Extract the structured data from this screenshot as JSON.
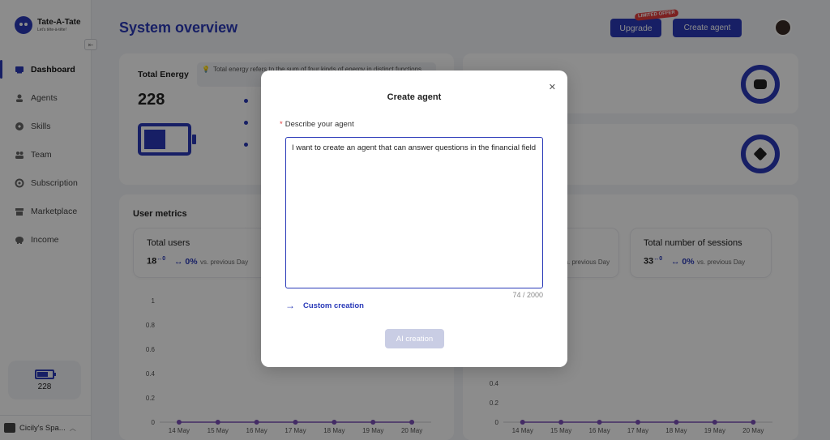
{
  "app": {
    "name": "Tate-A-Tate",
    "tagline": "Let's tête-à-tête!"
  },
  "sidebar": {
    "items": [
      {
        "label": "Dashboard",
        "icon": "dashboard-icon",
        "active": true
      },
      {
        "label": "Agents",
        "icon": "agents-icon"
      },
      {
        "label": "Skills",
        "icon": "skills-icon"
      },
      {
        "label": "Team",
        "icon": "team-icon"
      },
      {
        "label": "Subscription",
        "icon": "subscription-icon"
      },
      {
        "label": "Marketplace",
        "icon": "marketplace-icon"
      },
      {
        "label": "Income",
        "icon": "income-icon"
      }
    ],
    "energy_value": "228",
    "workspace": "Cicily's Spa..."
  },
  "header": {
    "title": "System overview",
    "upgrade_label": "Upgrade",
    "offer_badge": "LIMITED OFFER",
    "create_agent_label": "Create agent"
  },
  "energy_card": {
    "title": "Total Energy",
    "value": "228",
    "tip": "Total energy refers to the sum of four kinds of energy in distinct functions."
  },
  "metrics": {
    "title": "User metrics",
    "total_users": {
      "label": "Total users",
      "value": "18",
      "delta_sup": "0",
      "pct": "0%",
      "vs": "vs. previous Day"
    },
    "partial": {
      "vs": "vs. previous Day"
    },
    "sessions": {
      "label": "Total number of sessions",
      "value": "33",
      "delta_sup": "0",
      "pct": "0%",
      "vs": "vs. previous Day"
    }
  },
  "chart_data": [
    {
      "type": "line",
      "x": [
        "14 May",
        "15 May",
        "16 May",
        "17 May",
        "18 May",
        "19 May",
        "20 May"
      ],
      "series": [
        {
          "values": [
            0,
            0,
            0,
            0,
            0,
            0,
            0
          ]
        }
      ],
      "yticks": [
        "1",
        "0.8",
        "0.6",
        "0.4",
        "0.2",
        "0"
      ],
      "ylim": [
        0,
        1
      ],
      "color": "#7b4fb8"
    },
    {
      "type": "line",
      "x": [
        "14 May",
        "15 May",
        "16 May",
        "17 May",
        "18 May",
        "19 May",
        "20 May"
      ],
      "series": [
        {
          "values": [
            0,
            0,
            0,
            0,
            0,
            0,
            0
          ]
        }
      ],
      "yticks": [
        "0.4",
        "0.2",
        "0"
      ],
      "ylim": [
        0,
        1
      ],
      "color": "#7b4fb8"
    }
  ],
  "modal": {
    "title": "Create agent",
    "field_label": "Describe your agent",
    "textarea_value": "I want to create an agent that can answer questions in the financial field",
    "char_count": "74 / 2000",
    "custom_link": "Custom creation",
    "ai_button": "AI creation"
  },
  "colors": {
    "accent": "#2a3ab8",
    "line": "#7b4fb8",
    "badge": "#e23c3c"
  }
}
